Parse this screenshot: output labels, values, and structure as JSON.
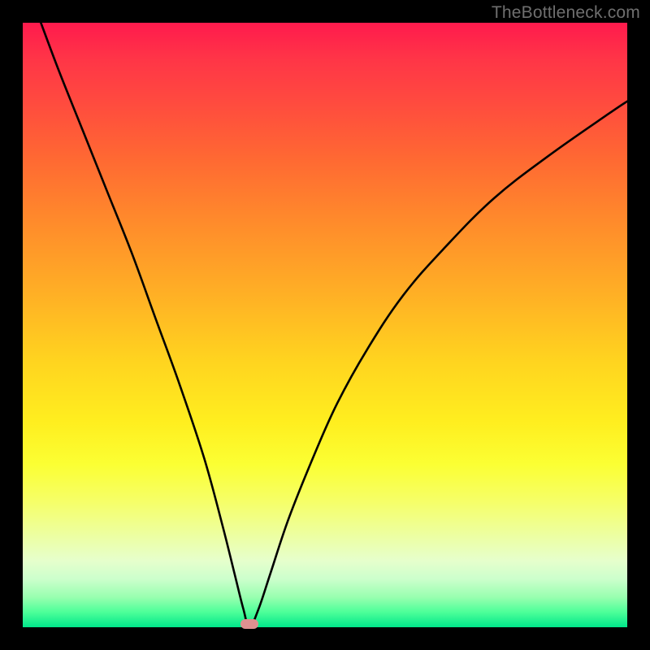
{
  "watermark": "TheBottleneck.com",
  "marker": {
    "x_pct": 37.5,
    "y_pct": 99.5,
    "color": "#e09090"
  },
  "chart_data": {
    "type": "line",
    "title": "",
    "xlabel": "",
    "ylabel": "",
    "xlim": [
      0,
      100
    ],
    "ylim": [
      0,
      100
    ],
    "grid": false,
    "legend": false,
    "series": [
      {
        "name": "bottleneck-curve",
        "x": [
          3,
          6,
          10,
          14,
          18,
          22,
          26,
          30,
          33,
          35,
          36.5,
          37.5,
          39,
          41,
          44,
          48,
          52,
          57,
          63,
          70,
          78,
          87,
          97,
          100
        ],
        "y": [
          100,
          92,
          82,
          72,
          62,
          51,
          40,
          28,
          17,
          9,
          3,
          0,
          3,
          9,
          18,
          28,
          37,
          46,
          55,
          63,
          71,
          78,
          85,
          87
        ]
      }
    ],
    "annotations": [
      {
        "type": "marker",
        "x": 37.5,
        "y": 0,
        "shape": "pill",
        "color": "#e09090"
      }
    ],
    "background_gradient": {
      "direction": "vertical",
      "stops": [
        {
          "pos": 0.0,
          "color": "#ff1a4d"
        },
        {
          "pos": 0.33,
          "color": "#ff8b2b"
        },
        {
          "pos": 0.66,
          "color": "#ffee1f"
        },
        {
          "pos": 1.0,
          "color": "#00e68a"
        }
      ]
    }
  }
}
